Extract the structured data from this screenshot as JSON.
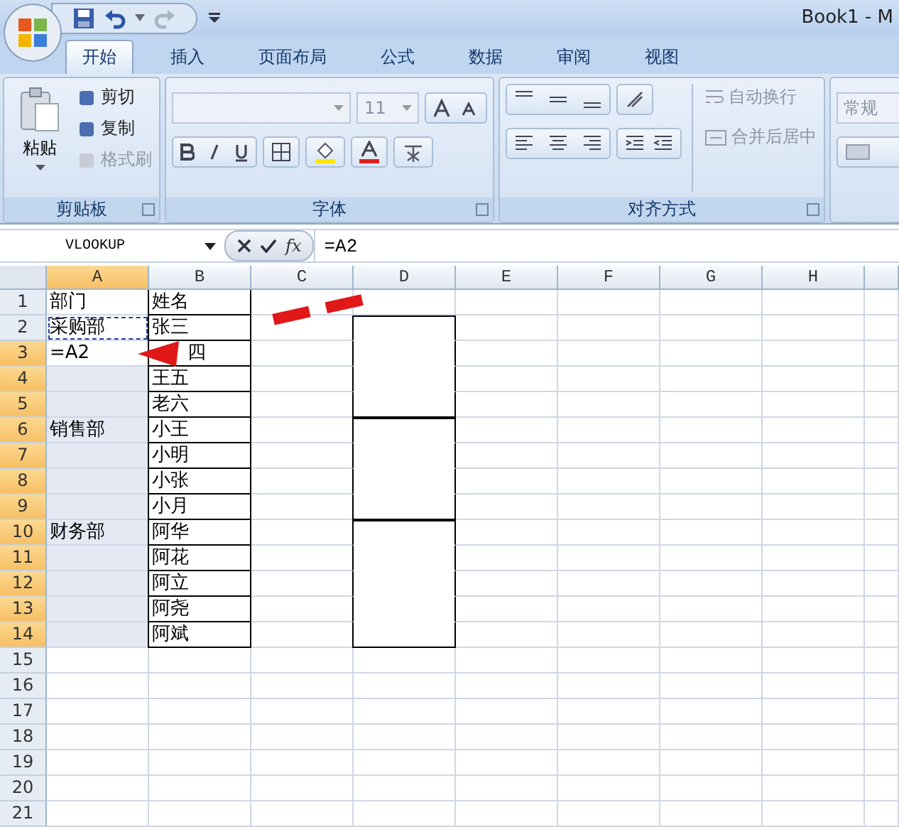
{
  "window": {
    "title": "Book1 - M"
  },
  "tabs": [
    {
      "label": "开始",
      "selected": true
    },
    {
      "label": "插入",
      "selected": false
    },
    {
      "label": "页面布局",
      "selected": false
    },
    {
      "label": "公式",
      "selected": false
    },
    {
      "label": "数据",
      "selected": false
    },
    {
      "label": "审阅",
      "selected": false
    },
    {
      "label": "视图",
      "selected": false
    }
  ],
  "clipboard": {
    "name": "剪贴板",
    "paste": "粘贴",
    "items": [
      {
        "label": "剪切",
        "disabled": false
      },
      {
        "label": "复制",
        "disabled": false
      },
      {
        "label": "格式刷",
        "disabled": true
      }
    ]
  },
  "font": {
    "name": "字体",
    "size": "11"
  },
  "alignment": {
    "name": "对齐方式",
    "wrap": "自动换行",
    "merge": "合并后居中"
  },
  "number": {
    "format": "常规"
  },
  "formula_bar": {
    "name_box": "VLOOKUP",
    "fx": "fx",
    "formula": "=A2"
  },
  "columns": [
    {
      "label": "A",
      "selected": true
    },
    {
      "label": "B",
      "selected": false
    },
    {
      "label": "C",
      "selected": false
    },
    {
      "label": "D",
      "selected": false
    },
    {
      "label": "E",
      "selected": false
    },
    {
      "label": "F",
      "selected": false
    },
    {
      "label": "G",
      "selected": false
    },
    {
      "label": "H",
      "selected": false
    }
  ],
  "rows": [
    {
      "label": "1",
      "selected": false,
      "a_selected": false,
      "copy_source": false,
      "a": "部门",
      "b": "姓名",
      "b_boxed": true,
      "b_covered": false,
      "d_boxed": false
    },
    {
      "label": "2",
      "selected": false,
      "a_selected": false,
      "copy_source": true,
      "a": "采购部",
      "b": "张三",
      "b_boxed": true,
      "b_covered": false,
      "d_boxed": true,
      "d_group_start": true
    },
    {
      "label": "3",
      "selected": true,
      "a_selected": false,
      "copy_source": false,
      "a": "=A2",
      "b": "四",
      "b_boxed": true,
      "b_covered": true,
      "d_boxed": true,
      "d_group_start": false
    },
    {
      "label": "4",
      "selected": true,
      "a_selected": true,
      "copy_source": false,
      "b": "王五",
      "b_boxed": true,
      "b_covered": false,
      "d_boxed": true,
      "d_group_start": false
    },
    {
      "label": "5",
      "selected": true,
      "a_selected": true,
      "copy_source": false,
      "b": "老六",
      "b_boxed": true,
      "b_covered": false,
      "d_boxed": true,
      "d_group_start": false
    },
    {
      "label": "6",
      "selected": true,
      "a_selected": true,
      "copy_source": false,
      "a": "销售部",
      "b": "小王",
      "b_boxed": true,
      "b_covered": false,
      "d_boxed": true,
      "d_group_start": true
    },
    {
      "label": "7",
      "selected": true,
      "a_selected": true,
      "copy_source": false,
      "b": "小明",
      "b_boxed": true,
      "b_covered": false,
      "d_boxed": true,
      "d_group_start": false
    },
    {
      "label": "8",
      "selected": true,
      "a_selected": true,
      "copy_source": false,
      "b": "小张",
      "b_boxed": true,
      "b_covered": false,
      "d_boxed": true,
      "d_group_start": false
    },
    {
      "label": "9",
      "selected": true,
      "a_selected": true,
      "copy_source": false,
      "b": "小月",
      "b_boxed": true,
      "b_covered": false,
      "d_boxed": true,
      "d_group_start": false
    },
    {
      "label": "10",
      "selected": true,
      "a_selected": true,
      "copy_source": false,
      "a": "财务部",
      "b": "阿华",
      "b_boxed": true,
      "b_covered": false,
      "d_boxed": true,
      "d_group_start": true
    },
    {
      "label": "11",
      "selected": true,
      "a_selected": true,
      "copy_source": false,
      "b": "阿花",
      "b_boxed": true,
      "b_covered": false,
      "d_boxed": true,
      "d_group_start": false
    },
    {
      "label": "12",
      "selected": true,
      "a_selected": true,
      "copy_source": false,
      "b": "阿立",
      "b_boxed": true,
      "b_covered": false,
      "d_boxed": true,
      "d_group_start": false
    },
    {
      "label": "13",
      "selected": true,
      "a_selected": true,
      "copy_source": false,
      "b": "阿尧",
      "b_boxed": true,
      "b_covered": false,
      "d_boxed": true,
      "d_group_start": false
    },
    {
      "label": "14",
      "selected": true,
      "a_selected": true,
      "copy_source": false,
      "b": "阿斌",
      "b_boxed": true,
      "b_covered": false,
      "d_boxed": true,
      "d_group_start": false
    },
    {
      "label": "15",
      "selected": false,
      "a_selected": false,
      "copy_source": false,
      "b_boxed": false,
      "d_boxed": false
    },
    {
      "label": "16",
      "selected": false,
      "a_selected": false,
      "copy_source": false,
      "b_boxed": false,
      "d_boxed": false
    },
    {
      "label": "17",
      "selected": false,
      "a_selected": false,
      "copy_source": false,
      "b_boxed": false,
      "d_boxed": false
    },
    {
      "label": "18",
      "selected": false,
      "a_selected": false,
      "copy_source": false,
      "b_boxed": false,
      "d_boxed": false
    },
    {
      "label": "19",
      "selected": false,
      "a_selected": false,
      "copy_source": false,
      "b_boxed": false,
      "d_boxed": false
    },
    {
      "label": "20",
      "selected": false,
      "a_selected": false,
      "copy_source": false,
      "b_boxed": false,
      "d_boxed": false
    },
    {
      "label": "21",
      "selected": false,
      "a_selected": false,
      "copy_source": false,
      "b_boxed": false,
      "d_boxed": false
    }
  ]
}
